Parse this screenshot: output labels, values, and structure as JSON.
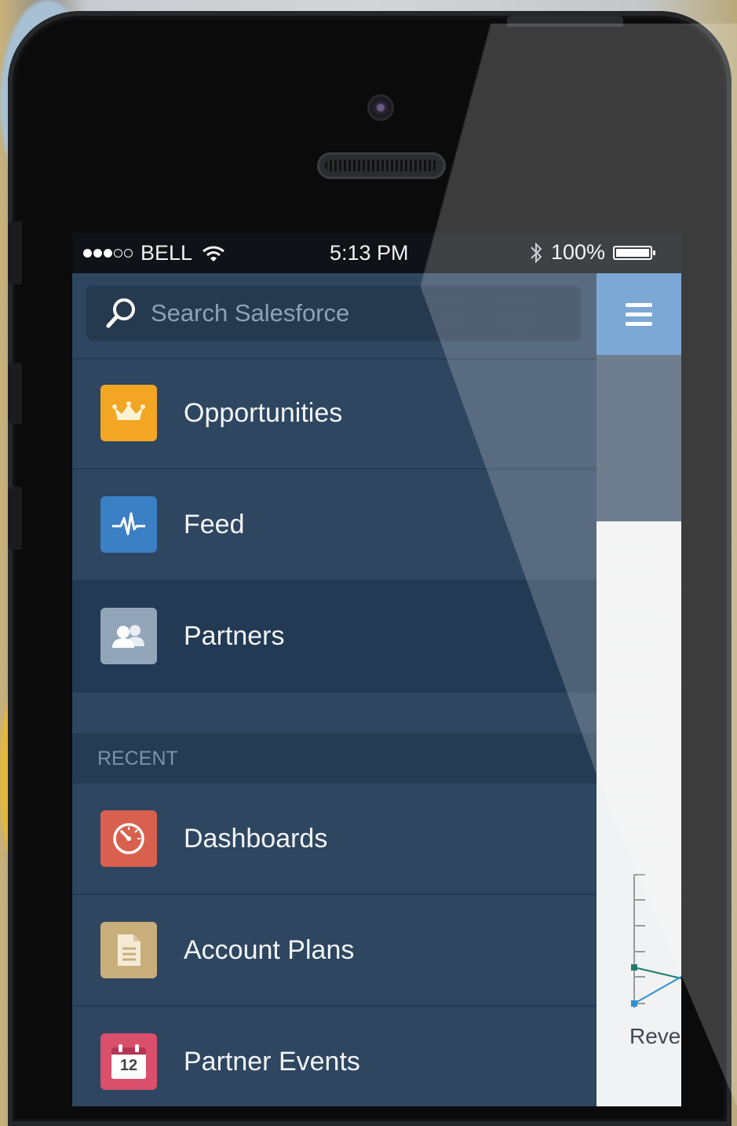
{
  "status_bar": {
    "signal_dots": [
      "on",
      "on",
      "on",
      "off",
      "off"
    ],
    "carrier": "BELL",
    "time": "5:13 PM",
    "battery": "100%"
  },
  "search": {
    "placeholder": "Search Salesforce"
  },
  "menu": {
    "items": [
      {
        "label": "Opportunities",
        "icon": "crown-icon",
        "color": "#f2a623"
      },
      {
        "label": "Feed",
        "icon": "pulse-icon",
        "color": "#3b7fc4"
      },
      {
        "label": "Partners",
        "icon": "people-icon",
        "color": "#93a5b8"
      }
    ],
    "section_label": "RECENT",
    "recent": [
      {
        "label": "Dashboards",
        "icon": "gauge-icon",
        "color": "#d9604f"
      },
      {
        "label": "Account Plans",
        "icon": "document-icon",
        "color": "#c8ae7b"
      },
      {
        "label": "Partner Events",
        "icon": "calendar-icon",
        "color": "#d94f6c",
        "badge": "12"
      }
    ]
  },
  "right_pane": {
    "accent": "#5b93cc",
    "chart_label_partial": "Reve"
  }
}
